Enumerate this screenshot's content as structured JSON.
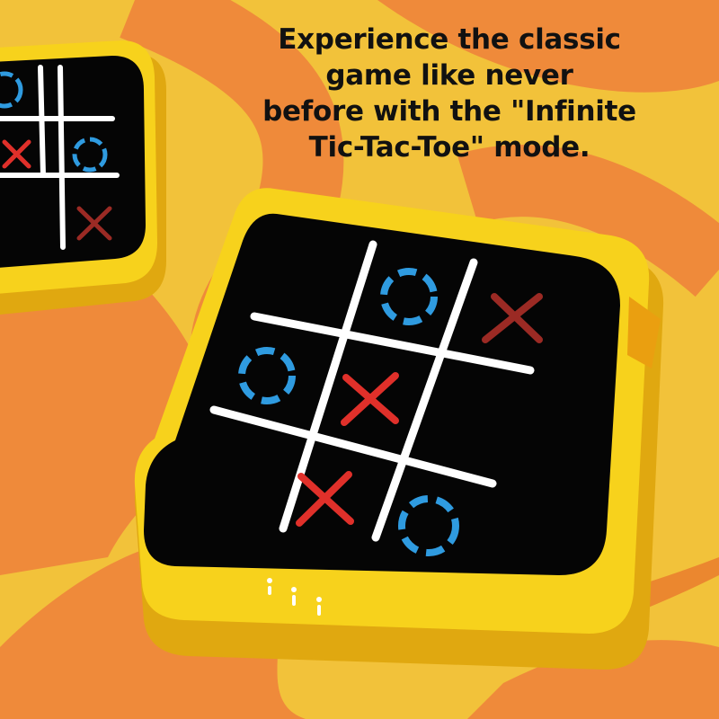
{
  "headline": {
    "lines": [
      "Experience the classic",
      "game like never",
      "before with the \"Infinite",
      "Tic-Tac-Toe\" mode."
    ]
  },
  "colors": {
    "background_yellow": "#f2c23a",
    "swirl_orange": "#ef8a3a",
    "device_yellow": "#f7d21c",
    "device_shadow": "#e0a810",
    "screen": "#050505",
    "grid": "#ffffff",
    "o_blue": "#2f9be0",
    "x_red": "#e0302a",
    "x_faded": "#9b2a24"
  },
  "main_board": {
    "cells": [
      [
        "",
        "O",
        "X-faded"
      ],
      [
        "O",
        "X",
        ""
      ],
      [
        "",
        "X",
        "O"
      ]
    ],
    "indicator_icons": [
      "led-dot-icon",
      "led-dot-icon",
      "led-dot-icon"
    ]
  },
  "secondary_board": {
    "cells_visible": [
      [
        "O",
        ""
      ],
      [
        "X",
        "O"
      ],
      [
        "",
        "X-faded"
      ]
    ]
  }
}
